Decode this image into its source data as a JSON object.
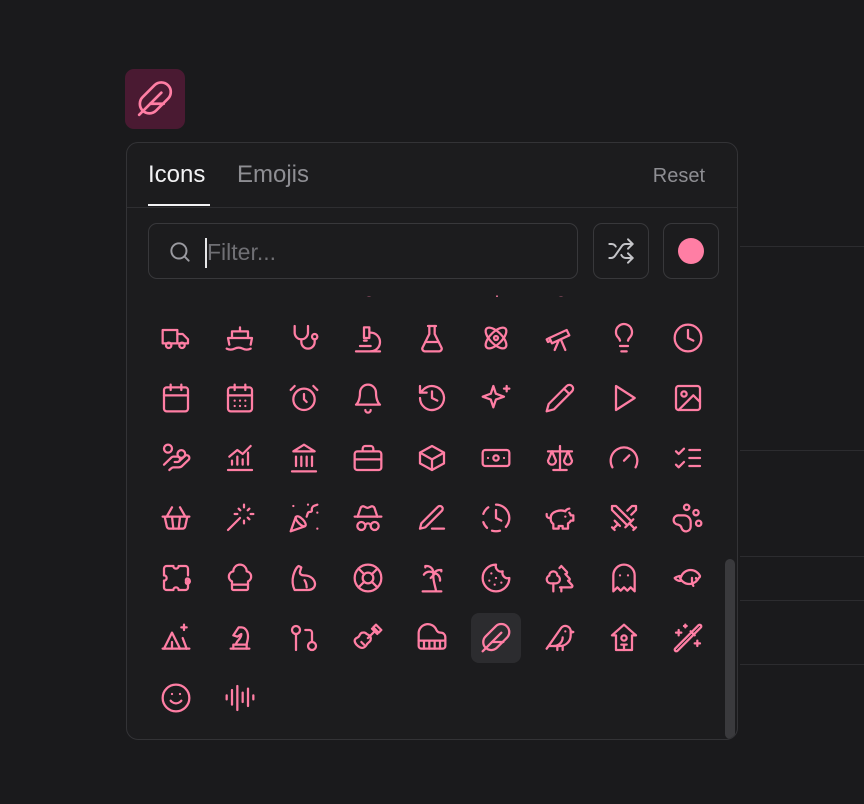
{
  "accent": "#ff7ea4",
  "selected_icon": "feather-icon",
  "tabs": [
    {
      "label": "Icons",
      "active": true
    },
    {
      "label": "Emojis",
      "active": false
    }
  ],
  "reset_label": "Reset",
  "search": {
    "placeholder": "Filter...",
    "value": ""
  },
  "color_swatch": "#ff7ea4",
  "icons": [
    [
      "truck-icon",
      "ship-icon",
      "stethoscope-icon",
      "microscope-icon",
      "flask-icon",
      "atom-icon",
      "telescope-icon",
      "lightbulb-icon",
      "clock-icon"
    ],
    [
      "calendar-icon",
      "calendar-days-icon",
      "alarm-clock-icon",
      "bell-icon",
      "history-icon",
      "sparkles-icon",
      "pencil-icon",
      "play-icon",
      "image-icon"
    ],
    [
      "hand-coins-icon",
      "chart-line-up-icon",
      "landmark-icon",
      "briefcase-icon",
      "box-icon",
      "banknote-icon",
      "scale-icon",
      "gauge-icon",
      "list-checks-icon"
    ],
    [
      "shopping-basket-icon",
      "magic-wand-icon",
      "party-popper-icon",
      "incognito-icon",
      "pen-line-icon",
      "clock-dashed-icon",
      "piggy-bank-icon",
      "swords-icon",
      "paw-print-icon"
    ],
    [
      "puzzle-icon",
      "chef-hat-icon",
      "biceps-icon",
      "life-buoy-icon",
      "palm-tree-icon",
      "cookie-icon",
      "trees-icon",
      "ghost-icon",
      "fish-icon"
    ],
    [
      "camping-icon",
      "chess-knight-icon",
      "git-pull-request-icon",
      "guitar-icon",
      "piano-icon",
      "feather-icon",
      "bird-icon",
      "birdhouse-icon",
      "wand-sparkles-icon"
    ],
    [
      "smile-icon",
      "audio-lines-icon"
    ]
  ]
}
